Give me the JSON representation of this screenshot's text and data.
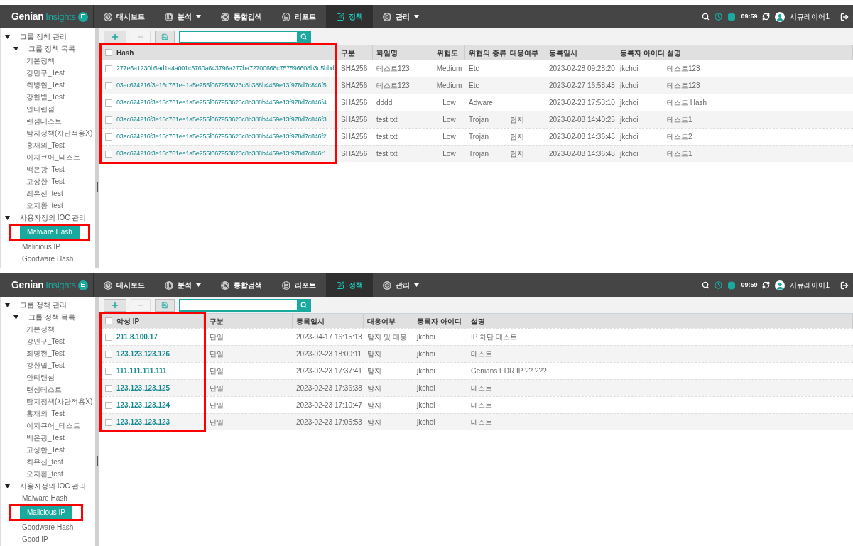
{
  "panels": [
    {
      "kind": "hash",
      "logo": {
        "name": "Genian",
        "sub": "Insights",
        "badge": "E"
      },
      "nav": [
        {
          "label": "대시보드",
          "selected": false,
          "dropdown": false
        },
        {
          "label": "분석",
          "selected": false,
          "dropdown": true
        },
        {
          "label": "통합검색",
          "selected": false,
          "dropdown": false
        },
        {
          "label": "리포트",
          "selected": false,
          "dropdown": false
        },
        {
          "label": "정책",
          "selected": true,
          "dropdown": false
        },
        {
          "label": "관리",
          "selected": false,
          "dropdown": true
        }
      ],
      "status": {
        "time": "09:59",
        "user": "시큐레이어1"
      },
      "sidebar": [
        {
          "label": "그룹 정책 관리",
          "expanded": true,
          "children": [
            {
              "label": "그룹 정책 목록",
              "expanded": true,
              "children": [
                {
                  "label": "기본정책",
                  "selected": false
                },
                {
                  "label": "강민구_Test",
                  "selected": false
                },
                {
                  "label": "최병현_Test",
                  "selected": false
                },
                {
                  "label": "강한별_Test",
                  "selected": false
                },
                {
                  "label": "안티랜섬",
                  "selected": false
                },
                {
                  "label": "랜섬테스트",
                  "selected": false
                },
                {
                  "label": "탐지정책(차단적용X)",
                  "selected": false
                },
                {
                  "label": "홍재의_Test",
                  "selected": false
                },
                {
                  "label": "이지큐어_테스트",
                  "selected": false
                },
                {
                  "label": "백은광_Test",
                  "selected": false
                },
                {
                  "label": "고상한_Test",
                  "selected": false
                },
                {
                  "label": "최유신_test",
                  "selected": false
                },
                {
                  "label": "오지환_test",
                  "selected": false
                }
              ]
            }
          ]
        },
        {
          "label": "사용자정의 IOC 관리",
          "expanded": true,
          "children": [
            {
              "label": "Malware Hash",
              "selected": true,
              "highlighted": true
            },
            {
              "label": "Malicious IP",
              "selected": false,
              "highlighted": false
            },
            {
              "label": "Goodware Hash",
              "selected": false,
              "highlighted": false
            }
          ]
        }
      ],
      "table": {
        "columns": [
          {
            "label": "Hash",
            "highlighted": true
          },
          {
            "label": "구분"
          },
          {
            "label": "파일명"
          },
          {
            "label": "위험도"
          },
          {
            "label": "위협의 종류"
          },
          {
            "label": "대응여부"
          },
          {
            "label": "등록일시"
          },
          {
            "label": "등록자 아이디"
          },
          {
            "label": "설명"
          }
        ],
        "rows": [
          {
            "checked": false,
            "cells": [
              "277e6a1230b5ad1a4a001c5760a643796a277ba72700668c757596608b3d5bbd",
              "SHA256",
              "테스트123",
              "Medium",
              "Etc",
              "",
              "2023-02-28 09:28:20",
              "jkchoi",
              "테스트123"
            ]
          },
          {
            "checked": false,
            "cells": [
              "03ac674216f3e15c761ee1a5e255f067953623c8b388b4459e13f978d7c846f5",
              "SHA256",
              "테스트123",
              "Medium",
              "Etc",
              "",
              "2023-02-27 16:58:48",
              "jkchoi",
              "테스트123"
            ]
          },
          {
            "checked": false,
            "cells": [
              "03ac674216f3e15c761ee1a5e255f067953623c8b388b4459e13f978d7c846f4",
              "SHA256",
              "dddd",
              "Low",
              "Adware",
              "",
              "2023-02-23 17:53:10",
              "jkchoi",
              "테스트 Hash"
            ]
          },
          {
            "checked": false,
            "cells": [
              "03ac674216f3e15c761ee1a5e255f067953623c8b388b4459e13f978d7c846f3",
              "SHA256",
              "test.txt",
              "Low",
              "Trojan",
              "탐지",
              "2023-02-08 14:40:25",
              "jkchoi",
              "테스트1"
            ]
          },
          {
            "checked": false,
            "cells": [
              "03ac674216f3e15c761ee1a5e255f067953623c8b388b4459e13f978d7c846f2",
              "SHA256",
              "test.txt",
              "Low",
              "Trojan",
              "탐지",
              "2023-02-08 14:36:48",
              "jkchoi",
              "테스트2"
            ]
          },
          {
            "checked": false,
            "cells": [
              "03ac674216f3e15c761ee1a5e255f067953623c8b388b4459e13f978d7c846f1",
              "SHA256",
              "test.txt",
              "Low",
              "Trojan",
              "탐지",
              "2023-02-08 14:36:48",
              "jkchoi",
              "테스트1"
            ]
          }
        ]
      }
    },
    {
      "kind": "ip",
      "logo": {
        "name": "Genian",
        "sub": "Insights",
        "badge": "E"
      },
      "nav": [
        {
          "label": "대시보드",
          "selected": false,
          "dropdown": false
        },
        {
          "label": "분석",
          "selected": false,
          "dropdown": true
        },
        {
          "label": "통합검색",
          "selected": false,
          "dropdown": false
        },
        {
          "label": "리포트",
          "selected": false,
          "dropdown": false
        },
        {
          "label": "정책",
          "selected": true,
          "dropdown": false
        },
        {
          "label": "관리",
          "selected": false,
          "dropdown": true
        }
      ],
      "status": {
        "time": "09:59",
        "user": "시큐레이어1"
      },
      "sidebar": [
        {
          "label": "그룹 정책 관리",
          "expanded": true,
          "children": [
            {
              "label": "그룹 정책 목록",
              "expanded": true,
              "children": [
                {
                  "label": "기본정책",
                  "selected": false
                },
                {
                  "label": "강민구_Test",
                  "selected": false
                },
                {
                  "label": "최병현_Test",
                  "selected": false
                },
                {
                  "label": "강한별_Test",
                  "selected": false
                },
                {
                  "label": "안티랜섬",
                  "selected": false
                },
                {
                  "label": "랜섬테스트",
                  "selected": false
                },
                {
                  "label": "탐지정책(차단적용X)",
                  "selected": false
                },
                {
                  "label": "홍재의_Test",
                  "selected": false
                },
                {
                  "label": "이지큐어_테스트",
                  "selected": false
                },
                {
                  "label": "백은광_Test",
                  "selected": false
                },
                {
                  "label": "고상한_Test",
                  "selected": false
                },
                {
                  "label": "최유신_test",
                  "selected": false
                },
                {
                  "label": "오지환_test",
                  "selected": false
                }
              ]
            }
          ]
        },
        {
          "label": "사용자정의 IOC 관리",
          "expanded": true,
          "children": [
            {
              "label": "Malware Hash",
              "selected": false,
              "highlighted": false
            },
            {
              "label": "Malicious IP",
              "selected": true,
              "highlighted": true
            },
            {
              "label": "Goodware Hash",
              "selected": false,
              "highlighted": false
            },
            {
              "label": "Good IP",
              "selected": false,
              "highlighted": false
            }
          ]
        }
      ],
      "table": {
        "columns": [
          {
            "label": "악성 IP",
            "highlighted": true
          },
          {
            "label": "구분"
          },
          {
            "label": "등록일시"
          },
          {
            "label": "대응여부"
          },
          {
            "label": "등록자 아이디"
          },
          {
            "label": "설명"
          }
        ],
        "rows": [
          {
            "checked": false,
            "cells": [
              "211.8.100.17",
              "단일",
              "2023-04-17 16:15:13",
              "탐지 및 대응",
              "jkchoi",
              "IP 차단 테스트"
            ]
          },
          {
            "checked": false,
            "cells": [
              "123.123.123.126",
              "단일",
              "2023-02-23 18:00:11",
              "탐지",
              "jkchoi",
              "테스트"
            ]
          },
          {
            "checked": false,
            "cells": [
              "111.111.111.111",
              "단일",
              "2023-02-23 17:37:41",
              "탐지",
              "jkchoi",
              "Genians EDR IP ?? ???"
            ]
          },
          {
            "checked": false,
            "cells": [
              "123.123.123.125",
              "단일",
              "2023-02-23 17:36:38",
              "탐지",
              "jkchoi",
              "테스트"
            ]
          },
          {
            "checked": false,
            "cells": [
              "123.123.123.124",
              "단일",
              "2023-02-23 17:10:47",
              "탐지",
              "jkchoi",
              "테스트"
            ]
          },
          {
            "checked": false,
            "cells": [
              "123.123.123.123",
              "단일",
              "2023-02-23 17:05:53",
              "탐지",
              "jkchoi",
              "테스트"
            ]
          }
        ]
      }
    }
  ]
}
